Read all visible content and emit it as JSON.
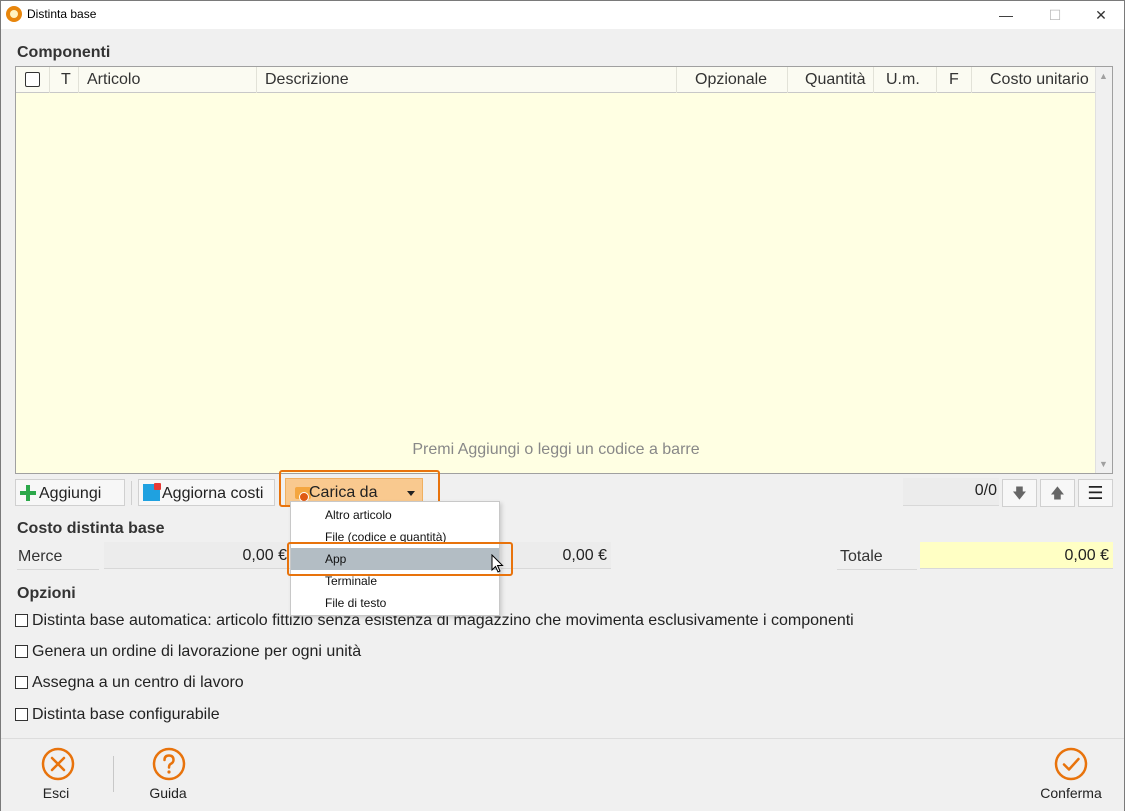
{
  "window": {
    "title": "Distinta base",
    "minimize_glyph": "—",
    "maximize_glyph": "☐",
    "close_glyph": "✕"
  },
  "components": {
    "section_title": "Componenti",
    "columns": [
      "T",
      "Articolo",
      "Descrizione",
      "Opzionale",
      "Quantità",
      "U.m.",
      "F",
      "Costo unitario"
    ],
    "rows": [],
    "empty_message": "Premi Aggiungi o leggi un codice a barre"
  },
  "toolbar": {
    "add_label": "Aggiungi",
    "update_costs_label": "Aggiorna costi",
    "load_from_label": "Carica da",
    "counter": "0/0"
  },
  "load_menu": {
    "items": [
      "Altro articolo",
      "File (codice e quantità)",
      "App",
      "Terminale",
      "File di testo"
    ],
    "selected": "App"
  },
  "cost": {
    "section_title": "Costo distinta base",
    "merce_label": "Merce",
    "merce_value": "0,00 €",
    "second_value": "0,00 €",
    "totale_label": "Totale",
    "totale_value": "0,00 €"
  },
  "options": {
    "section_title": "Opzioni",
    "items": [
      {
        "label": "Distinta base automatica: articolo fittizio senza esistenza di magazzino che movimenta esclusivamente i componenti",
        "checked": false
      },
      {
        "label": "Genera un ordine di lavorazione per ogni unità",
        "checked": false
      },
      {
        "label": "Assegna a un centro di lavoro",
        "checked": false
      },
      {
        "label": "Distinta base configurabile",
        "checked": false
      }
    ]
  },
  "footer": {
    "exit_label": "Esci",
    "help_label": "Guida",
    "confirm_label": "Conferma"
  },
  "colors": {
    "accent": "#e8730c",
    "grid_background": "#ffffe3",
    "total_field": "#ffffc4",
    "menu_selected": "#b3bdc4"
  }
}
